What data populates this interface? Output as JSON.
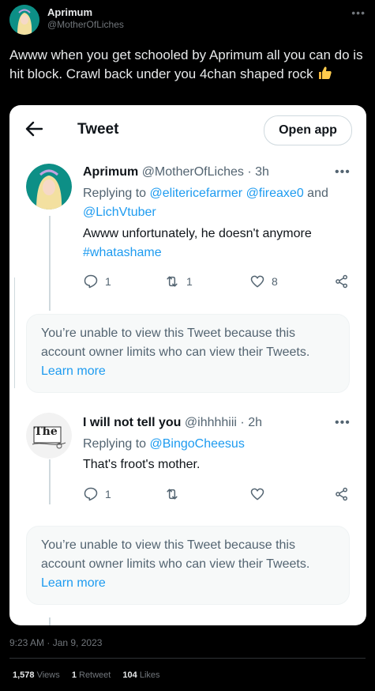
{
  "outer_tweet": {
    "author_name": "Aprimum",
    "author_handle": "@MotherOfLiches",
    "text": "Awww when you get schooled by Aprimum all you can do is hit block. Crawl back under you 4chan shaped rock",
    "emoji": "thumbs-up",
    "more_icon": "more-icon",
    "timestamp": "9:23 AM · Jan 9, 2023",
    "stats": {
      "views_count": "1,578",
      "views_label": "Views",
      "retweets_count": "1",
      "retweets_label": "Retweet",
      "likes_count": "104",
      "likes_label": "Likes"
    }
  },
  "screenshot": {
    "topbar": {
      "back_icon": "arrow-left-icon",
      "title": "Tweet",
      "open_app_label": "Open app"
    },
    "tweets": [
      {
        "name": "Aprimum",
        "handle": "@MotherOfLiches",
        "sep": " · ",
        "time": "3h",
        "replying_prefix": "Replying to ",
        "replying_to": [
          "@elitericefarmer",
          "@fireaxe0"
        ],
        "replying_and": " and ",
        "replying_last": "@LichVtuber",
        "body": "Awww unfortunately,  he doesn't anymore",
        "hashtag": "#whatashame",
        "replies": "1",
        "retweets": "1",
        "likes": "8"
      },
      {
        "name": "I will not tell you",
        "handle": "@ihhhhiii",
        "sep": " · ",
        "time": "2h",
        "replying_prefix": "Replying to ",
        "replying_last": "@BingoCheesus",
        "body": "That's froot's mother.",
        "replies": "1",
        "avatar_text": "The"
      }
    ],
    "notice": {
      "text": "You’re unable to view this Tweet because this account owner limits who can view their Tweets.",
      "link": "Learn more"
    }
  },
  "colors": {
    "link": "#1d9bf0",
    "background": "#000000",
    "card": "#ffffff",
    "avatar_teal": "#0d8f86"
  }
}
